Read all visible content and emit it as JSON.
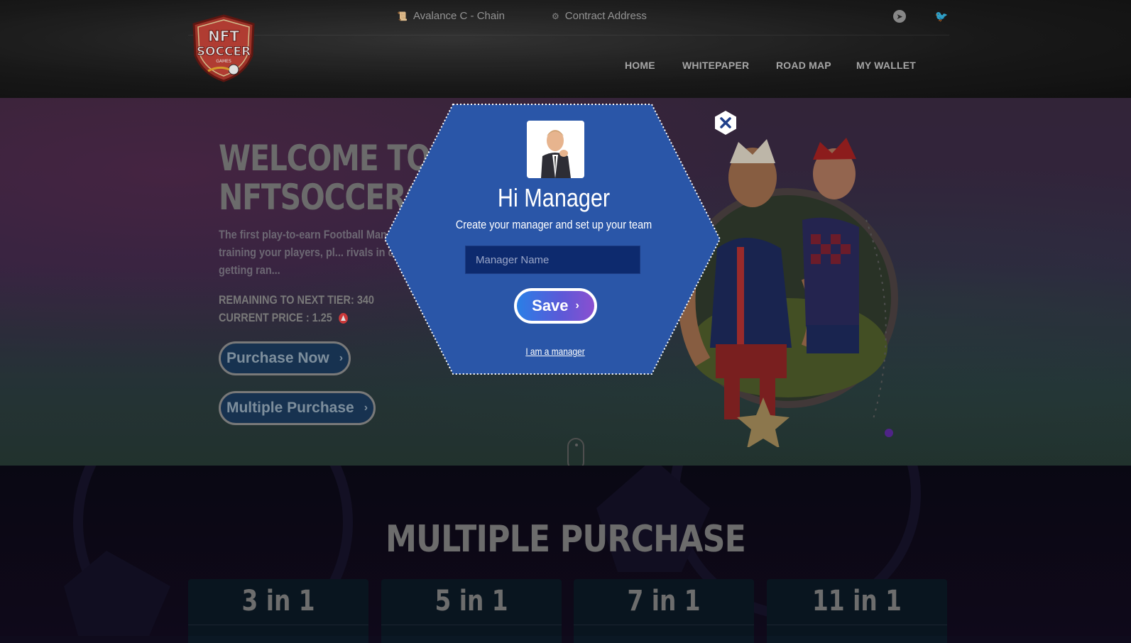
{
  "topbar": {
    "chain": {
      "label": "Avalance C - Chain",
      "icon": "scroll-icon"
    },
    "contract": {
      "label": "Contract Address",
      "icon": "gear-icon"
    },
    "social": [
      {
        "icon": "telegram-icon"
      },
      {
        "icon": "twitter-icon"
      }
    ]
  },
  "logo": {
    "line1": "NFT",
    "line2": "SOCCER",
    "line3": "GAMES"
  },
  "nav": [
    "HOME",
    "WHITEPAPER",
    "ROAD MAP",
    "MY WALLET"
  ],
  "hero": {
    "title_line1": "WELCOME TO",
    "title_line2": "NFTSOCCERGAMES",
    "description": "The first play-to-earn Football Mana... can earn by training your players, pl... rivals in death matches or getting ran...",
    "remaining": "REMAINING TO NEXT TIER: 340",
    "price": "CURRENT PRICE : 1.25",
    "purchase_label": "Purchase Now",
    "multiple_label": "Multiple Purchase"
  },
  "multiple": {
    "title": "MULTIPLE PURCHASE",
    "packs": [
      "3 in 1",
      "5 in 1",
      "7 in 1",
      "11 in 1"
    ]
  },
  "modal": {
    "title": "Hi Manager",
    "subtitle": "Create your manager and set up your team",
    "input_placeholder": "Manager Name",
    "save_label": "Save",
    "link_label": "I am a manager"
  },
  "colors": {
    "modal_bg": "#2a56a8",
    "accent_blue": "#2a7fe6",
    "accent_purple": "#8a4fd0",
    "avax_red": "#e84142"
  }
}
